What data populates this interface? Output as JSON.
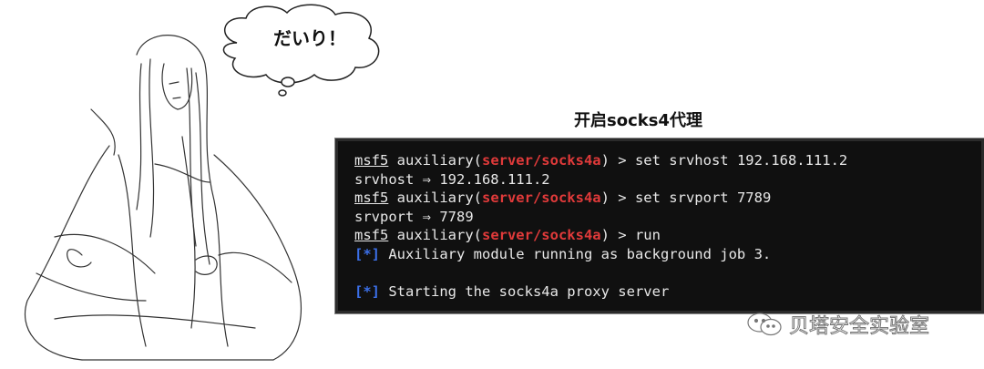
{
  "bubble": {
    "text": "だいり！"
  },
  "caption": "开启socks4代理",
  "terminal": {
    "lines": [
      {
        "prompt": "msf5",
        "mid": " auxiliary(",
        "module": "server/socks4a",
        "rest": ") > set srvhost 192.168.111.2"
      },
      {
        "text": "srvhost ⇒ 192.168.111.2"
      },
      {
        "prompt": "msf5",
        "mid": " auxiliary(",
        "module": "server/socks4a",
        "rest": ") > set srvport 7789"
      },
      {
        "text": "srvport ⇒ 7789"
      },
      {
        "prompt": "msf5",
        "mid": " auxiliary(",
        "module": "server/socks4a",
        "rest": ") > run"
      },
      {
        "tag": "[*]",
        "msg": " Auxiliary module running as background job 3."
      },
      {
        "text": ""
      },
      {
        "tag": "[*]",
        "msg": " Starting the socks4a proxy server"
      }
    ]
  },
  "watermark": "贝塔安全实验室",
  "colors": {
    "module": "#e03a3a",
    "tag": "#3b6fe8",
    "terminal_bg": "#101010"
  }
}
